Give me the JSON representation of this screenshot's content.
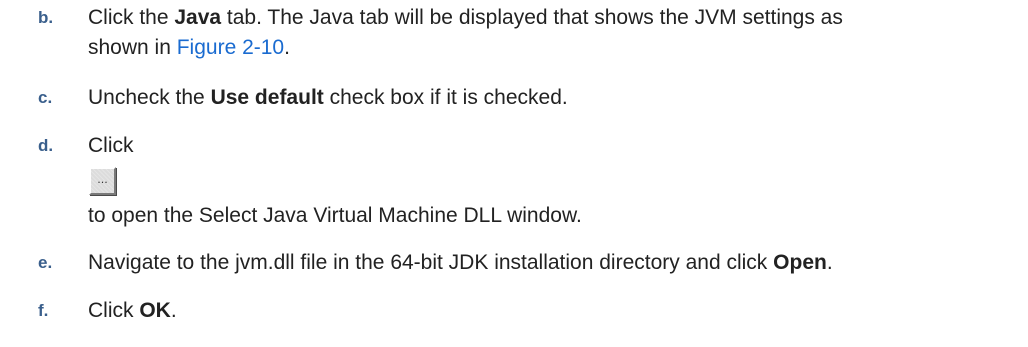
{
  "steps": [
    {
      "marker": "b.",
      "line1_a": "Click the ",
      "line1_bold": "Java",
      "line1_b": " tab. The Java tab will be displayed that shows the JVM settings as",
      "line2_a": "shown in ",
      "line2_link": "Figure 2-10",
      "line2_b": "."
    },
    {
      "marker": "c.",
      "text_a": "Uncheck the ",
      "text_bold": "Use default",
      "text_b": " check box if it is checked."
    },
    {
      "marker": "d.",
      "text_a": "Click",
      "button_glyph": "...",
      "text_b": "to open the Select Java Virtual Machine DLL window."
    },
    {
      "marker": "e.",
      "text_a": "Navigate to the jvm.dll file in the 64-bit JDK installation directory and click ",
      "text_bold": "Open",
      "text_b": "."
    },
    {
      "marker": "f.",
      "text_a": "Click ",
      "text_bold": "OK",
      "text_b": "."
    }
  ],
  "colors": {
    "marker": "#3a5f8c",
    "link": "#1a6bd0",
    "text": "#222222"
  }
}
